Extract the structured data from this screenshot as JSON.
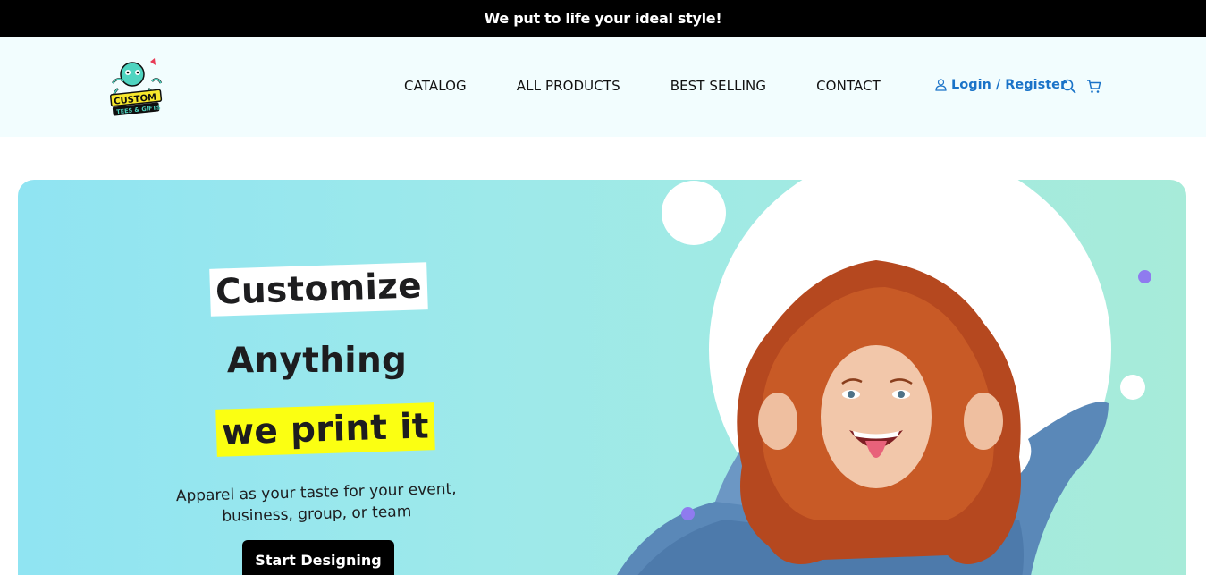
{
  "topbar": {
    "text": "We put to life your ideal style!"
  },
  "header": {
    "logo": {
      "line1": "CUSTOM",
      "line2": "TEES & GIFTS"
    },
    "nav": [
      {
        "label": "CATALOG"
      },
      {
        "label": "ALL PRODUCTS"
      },
      {
        "label": "BEST SELLING"
      },
      {
        "label": "CONTACT"
      }
    ],
    "account_label": "Login / Register",
    "icons": [
      "user-icon",
      "search-icon",
      "cart-icon"
    ]
  },
  "hero": {
    "line1": "Customize",
    "line2": "Anything",
    "line3": "we print it",
    "subtext": "Apparel as your taste for your event, business, group, or team",
    "cta_label": "Start Designing"
  },
  "colors": {
    "topbar_bg": "#000000",
    "header_bg": "#f2fdfe",
    "link_blue": "#1a73c8",
    "highlight_yellow": "#fbff12",
    "hero_start": "#90e4f2",
    "hero_end": "#a7ebd9",
    "accent_purple": "#8f7bef"
  }
}
